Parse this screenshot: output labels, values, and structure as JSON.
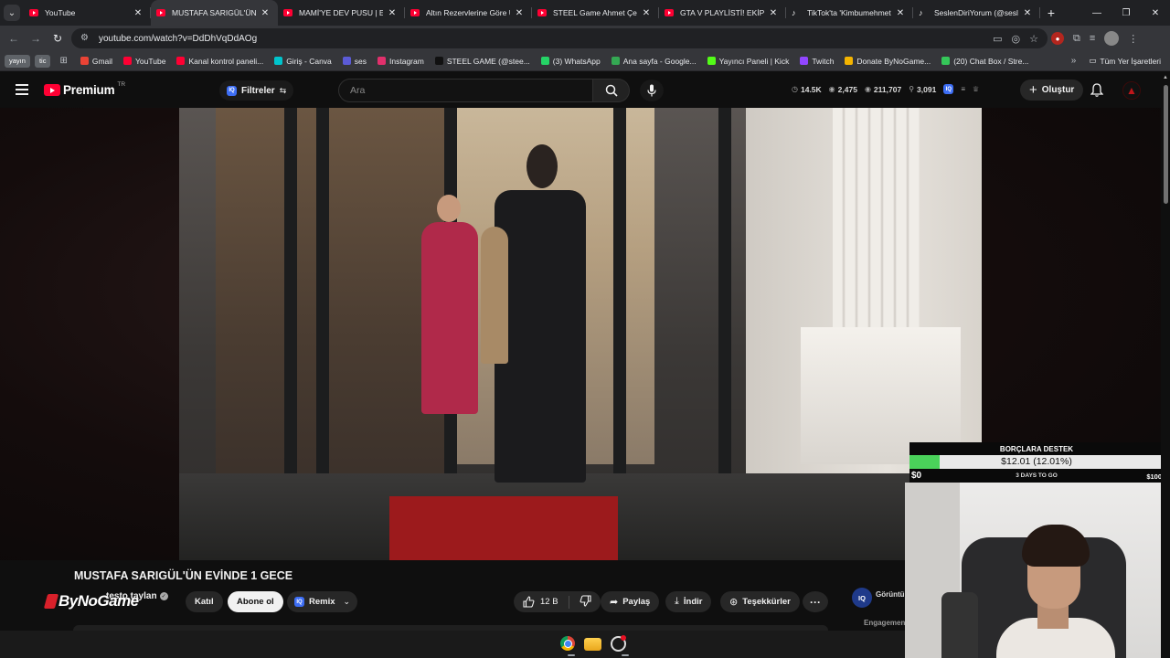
{
  "browser": {
    "tabs": [
      {
        "title": "YouTube",
        "favicon": "youtube-icon",
        "active": false
      },
      {
        "title": "MUSTAFA SARIGÜL'ÜN EVİ",
        "favicon": "youtube-icon",
        "active": true
      },
      {
        "title": "MAMİ'YE DEV PUSU | EVİM",
        "favicon": "youtube-icon",
        "active": false
      },
      {
        "title": "Altın Rezervlerine Göre Ül",
        "favicon": "youtube-icon",
        "active": false
      },
      {
        "title": "STEEL Game Ahmet Çelik",
        "favicon": "youtube-icon",
        "active": false
      },
      {
        "title": "GTA V PLAYLİSTİ! EKİP ÇIL",
        "favicon": "youtube-icon",
        "active": false
      },
      {
        "title": "TikTok'ta 'Kimbumehmet",
        "favicon": "tiktok-icon",
        "active": false
      },
      {
        "title": "SeslenDiriYorum (@sesle",
        "favicon": "tiktok-icon",
        "active": false
      }
    ],
    "new_tab": "+",
    "url": "youtube.com/watch?v=DdDhVqDdAOg",
    "bookmark_chips": [
      "yayın",
      "tic"
    ],
    "bookmarks": [
      {
        "label": "Gmail",
        "color": "#ea4335"
      },
      {
        "label": "YouTube",
        "color": "#ff0033"
      },
      {
        "label": "Kanal kontrol paneli...",
        "color": "#ff0033"
      },
      {
        "label": "Giriş - Canva",
        "color": "#00c4cc"
      },
      {
        "label": "ses",
        "color": "#5b5bd6"
      },
      {
        "label": "Instagram",
        "color": "#e1306c"
      },
      {
        "label": "STEEL GAME (@stee...",
        "color": "#111111"
      },
      {
        "label": "(3) WhatsApp",
        "color": "#25d366"
      },
      {
        "label": "Ana sayfa - Google...",
        "color": "#34a853"
      },
      {
        "label": "Yayıncı Paneli | Kick",
        "color": "#53fc18"
      },
      {
        "label": "Twitch",
        "color": "#9146ff"
      },
      {
        "label": "Donate ByNoGame...",
        "color": "#f4b400"
      },
      {
        "label": "(20) Chat Box / Stre...",
        "color": "#35c759"
      }
    ],
    "bookmarks_more": "»",
    "all_bookmarks": "Tüm Yer İşaretleri"
  },
  "youtube": {
    "logo_text": "Premium",
    "country_code": "TR",
    "filters_label": "Filtreler",
    "search_placeholder": "Ara",
    "stats": [
      {
        "icon": "clock-icon",
        "value": "14.5K"
      },
      {
        "icon": "eye-icon",
        "value": "2,475"
      },
      {
        "icon": "eye-icon",
        "value": "211,707"
      },
      {
        "icon": "person-icon",
        "value": "3,091"
      }
    ],
    "create_label": "Oluştur"
  },
  "video": {
    "title": "MUSTAFA SARIGÜL'ÜN EVİNDE 1 GECE",
    "channel_name": "testo taylan",
    "overlay_brand": "ByNoGame",
    "join_label": "Katıl",
    "subscribe_label": "Abone ol",
    "remix_label": "Remix",
    "like_count": "12 B",
    "share_label": "Paylaş",
    "download_label": "İndir",
    "thanks_label": "Teşekkürler",
    "side_iq": "IQ",
    "side_tab": "Görüntü",
    "engagement_label": "Engagemen"
  },
  "donation": {
    "title": "BORÇLARA DESTEK",
    "amount": "$12.01 (12.01%)",
    "progress": 0.1201,
    "min": "$0",
    "max": "$100",
    "remaining": "3 DAYS TO GO",
    "fill_color": "#4ad25a"
  }
}
